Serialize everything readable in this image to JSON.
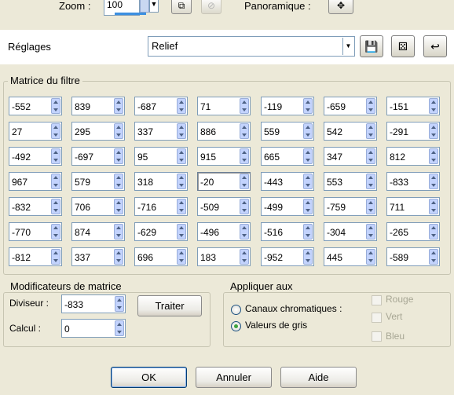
{
  "zoom": {
    "label": "Zoom :",
    "value": "100"
  },
  "panoramique": {
    "label": "Panoramique :"
  },
  "reglages": {
    "label": "Réglages",
    "value": "Relief"
  },
  "matrix": {
    "title": "Matrice du filtre",
    "rows": [
      [
        "-552",
        "839",
        "-687",
        "71",
        "-119",
        "-659",
        "-151"
      ],
      [
        "27",
        "295",
        "337",
        "886",
        "559",
        "542",
        "-291"
      ],
      [
        "-492",
        "-697",
        "95",
        "915",
        "665",
        "347",
        "812"
      ],
      [
        "967",
        "579",
        "318",
        "-20",
        "-443",
        "553",
        "-833"
      ],
      [
        "-832",
        "706",
        "-716",
        "-509",
        "-499",
        "-759",
        "711"
      ],
      [
        "-770",
        "874",
        "-629",
        "-496",
        "-516",
        "-304",
        "-265"
      ],
      [
        "-812",
        "337",
        "696",
        "183",
        "-952",
        "445",
        "-589"
      ]
    ],
    "focused_cell": "3,3"
  },
  "modifiers": {
    "title": "Modificateurs de matrice",
    "diviseur_label": "Diviseur :",
    "diviseur_value": "-833",
    "calcul_label": "Calcul :",
    "calcul_value": "0",
    "traiter_label": "Traiter"
  },
  "apply": {
    "title": "Appliquer aux",
    "canaux_label": "Canaux chromatiques :",
    "valeurs_label": "Valeurs de gris",
    "selected": "valeurs",
    "rouge_label": "Rouge",
    "vert_label": "Vert",
    "bleu_label": "Bleu"
  },
  "buttons": {
    "ok": "OK",
    "annuler": "Annuler",
    "aide": "Aide"
  },
  "icons": {
    "zoom_fit": "zoom-fit-icon",
    "zoom_reset": "zoom-reset-icon",
    "pan": "move-arrows-icon",
    "save": "floppy-save-icon",
    "random": "dice-icon",
    "reset": "undo-arrow-icon"
  },
  "colors": {
    "dialog_bg": "#ece9d8",
    "accent": "#3b8fe0",
    "spin_arrow": "#c3d3fd"
  }
}
